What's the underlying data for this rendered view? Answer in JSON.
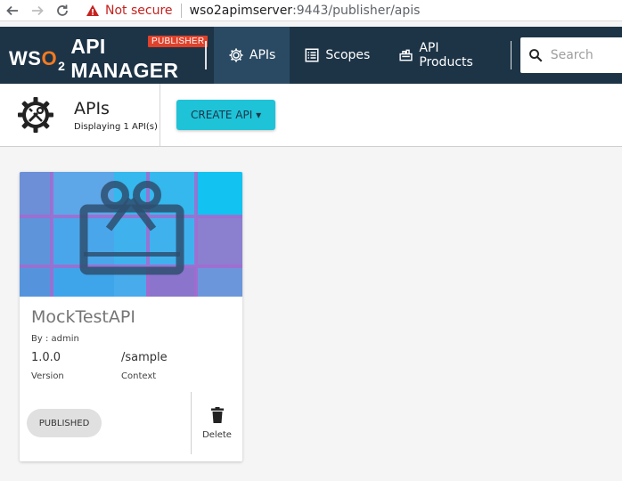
{
  "browser": {
    "not_secure": "Not secure",
    "url_host": "wso2apimserver",
    "url_path": ":9443/publisher/apis"
  },
  "header": {
    "logo_wso2_prefix": "WS",
    "logo_wso2_o": "O",
    "logo_wso2_sub": "2",
    "logo_product": "API MANAGER",
    "publisher_badge": "PUBLISHER",
    "nav": [
      {
        "label": "APIs",
        "icon": "gear-icon",
        "active": true
      },
      {
        "label": "Scopes",
        "icon": "list-icon",
        "active": false
      },
      {
        "label": "API Products",
        "icon": "products-icon",
        "active": false
      }
    ],
    "search": {
      "placeholder": "Search"
    }
  },
  "subheader": {
    "title": "APIs",
    "subtitle": "Displaying 1 API(s)",
    "create_button": "CREATE API ▾"
  },
  "api_card": {
    "name": "MockTestAPI",
    "by": "By : admin",
    "version": "1.0.0",
    "version_label": "Version",
    "context": "/sample",
    "context_label": "Context",
    "status": "PUBLISHED",
    "delete_label": "Delete"
  },
  "colors": {
    "header_bg": "#1d3447",
    "accent": "#1ec3d8",
    "badge": "#e0412a",
    "warning": "#c5221f"
  }
}
